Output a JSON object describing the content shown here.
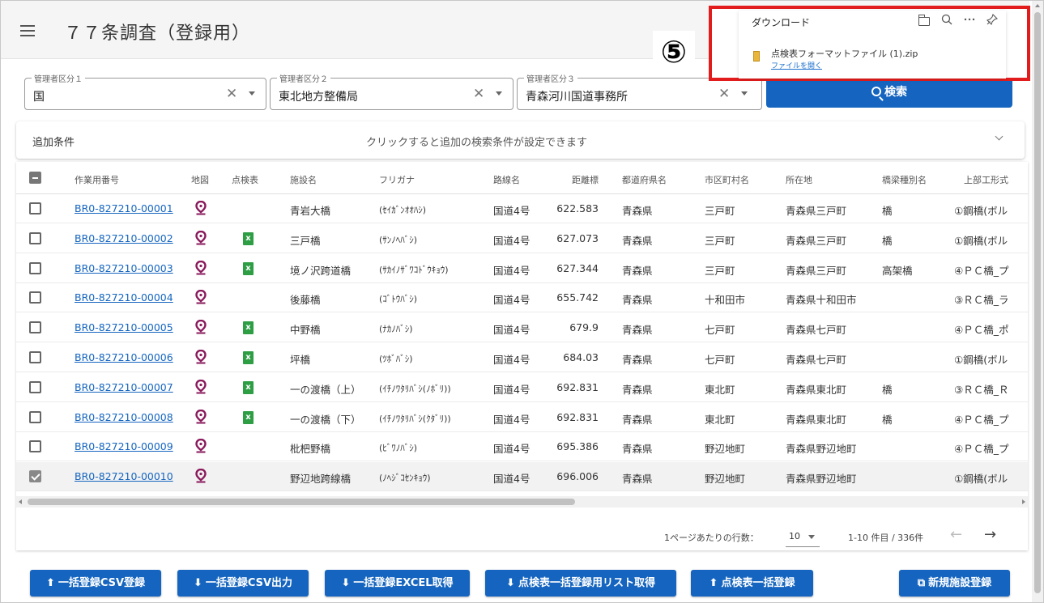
{
  "header": {
    "title": "７７条調査（登録用）"
  },
  "annotation": {
    "step_number": "⑤"
  },
  "download_panel": {
    "title": "ダウンロード",
    "icons": [
      "folder-icon",
      "search-icon",
      "more-icon",
      "pin-icon"
    ],
    "file_name": "点検表フォーマットファイル (1).zip",
    "open_link": "ファイルを開く"
  },
  "filters": {
    "field1": {
      "label": "管理者区分１",
      "value": "国"
    },
    "field2": {
      "label": "管理者区分２",
      "value": "東北地方整備局"
    },
    "field3": {
      "label": "管理者区分３",
      "value": "青森河川国道事務所"
    },
    "search_button": "検索"
  },
  "additional_conditions": {
    "label": "追加条件",
    "hint": "クリックすると追加の検索条件が設定できます"
  },
  "table": {
    "headers": {
      "id": "作業用番号",
      "map": "地図",
      "inspection": "点検表",
      "facility": "施設名",
      "furigana": "フリガナ",
      "route": "路線名",
      "distance": "距離標",
      "prefecture": "都道府県名",
      "city": "市区町村名",
      "location": "所在地",
      "bridge_type": "橋梁種別名",
      "structure": "上部工形式"
    },
    "rows": [
      {
        "id": "BR0-827210-00001",
        "has_sheet": false,
        "facility": "青岩大橋",
        "furigana": "(ｾｲｶﾞﾝｵｵﾊｼ)",
        "route": "国道4号",
        "distance": "622.583",
        "prefecture": "青森県",
        "city": "三戸町",
        "location": "青森県三戸町",
        "bridge_type": "橋",
        "structure": "①鋼橋(ボル",
        "checked": false
      },
      {
        "id": "BR0-827210-00002",
        "has_sheet": true,
        "facility": "三戸橋",
        "furigana": "(ｻﾝﾉﾍﾊﾞｼ)",
        "route": "国道4号",
        "distance": "627.073",
        "prefecture": "青森県",
        "city": "三戸町",
        "location": "青森県三戸町",
        "bridge_type": "橋",
        "structure": "①鋼橋(ボル",
        "checked": false
      },
      {
        "id": "BR0-827210-00003",
        "has_sheet": true,
        "facility": "境ノ沢跨道橋",
        "furigana": "(ｻｶｲﾉｻﾞﾜｺﾄﾞｳｷｮｳ)",
        "route": "国道4号",
        "distance": "627.344",
        "prefecture": "青森県",
        "city": "三戸町",
        "location": "青森県三戸町",
        "bridge_type": "高架橋",
        "structure": "④ＰＣ橋_プ",
        "checked": false
      },
      {
        "id": "BR0-827210-00004",
        "has_sheet": false,
        "facility": "後藤橋",
        "furigana": "(ｺﾞﾄｳﾊﾞｼ)",
        "route": "国道4号",
        "distance": "655.742",
        "prefecture": "青森県",
        "city": "十和田市",
        "location": "青森県十和田市",
        "bridge_type": "",
        "structure": "③ＲＣ橋_ラ",
        "checked": false
      },
      {
        "id": "BR0-827210-00005",
        "has_sheet": true,
        "facility": "中野橋",
        "furigana": "(ﾅｶﾉﾊﾞｼ)",
        "route": "国道4号",
        "distance": "679.9",
        "prefecture": "青森県",
        "city": "七戸町",
        "location": "青森県七戸町",
        "bridge_type": "",
        "structure": "④ＰＣ橋_ポ",
        "checked": false
      },
      {
        "id": "BR0-827210-00006",
        "has_sheet": true,
        "facility": "坪橋",
        "furigana": "(ﾂﾎﾞﾊﾞｼ)",
        "route": "国道4号",
        "distance": "684.03",
        "prefecture": "青森県",
        "city": "七戸町",
        "location": "青森県七戸町",
        "bridge_type": "",
        "structure": "①鋼橋(ボル",
        "checked": false
      },
      {
        "id": "BR0-827210-00007",
        "has_sheet": true,
        "facility": "一の渡橋（上）",
        "furigana": "(ｲﾁﾉﾜﾀﾘﾊﾞｼ(ﾉﾎﾞﾘ))",
        "route": "国道4号",
        "distance": "692.831",
        "prefecture": "青森県",
        "city": "東北町",
        "location": "青森県東北町",
        "bridge_type": "橋",
        "structure": "③ＲＣ橋_Ｒ",
        "checked": false
      },
      {
        "id": "BR0-827210-00008",
        "has_sheet": true,
        "facility": "一の渡橋（下）",
        "furigana": "(ｲﾁﾉﾜﾀﾘﾊﾞｼ(ｸﾀﾞﾘ))",
        "route": "国道4号",
        "distance": "692.831",
        "prefecture": "青森県",
        "city": "東北町",
        "location": "青森県東北町",
        "bridge_type": "橋",
        "structure": "④ＰＣ橋_プ",
        "checked": false
      },
      {
        "id": "BR0-827210-00009",
        "has_sheet": false,
        "facility": "枇杷野橋",
        "furigana": "(ﾋﾞﾜﾉﾊﾞｼ)",
        "route": "国道4号",
        "distance": "695.386",
        "prefecture": "青森県",
        "city": "野辺地町",
        "location": "青森県野辺地町",
        "bridge_type": "",
        "structure": "④ＰＣ橋_プ",
        "checked": false
      },
      {
        "id": "BR0-827210-00010",
        "has_sheet": false,
        "facility": "野辺地跨線橋",
        "furigana": "(ﾉﾍｼﾞｺｾﾝｷｮｳ)",
        "route": "国道4号",
        "distance": "696.006",
        "prefecture": "青森県",
        "city": "野辺地町",
        "location": "青森県野辺地町",
        "bridge_type": "",
        "structure": "①鋼橋(ボル",
        "checked": true
      }
    ]
  },
  "pagination": {
    "rows_per_page_label": "1ページあたりの行数：",
    "rows_per_page": "10",
    "range": "1-10 件目 / 336件",
    "prev": "←",
    "next": "→"
  },
  "buttons": {
    "bulk_csv_register": "一括登録CSV登録",
    "bulk_csv_export": "一括登録CSV出力",
    "bulk_excel_get": "一括登録EXCEL取得",
    "inspection_list_get": "点検表一括登録用リスト取得",
    "inspection_bulk_register": "点検表一括登録",
    "new_facility": "新規施設登録"
  },
  "colors": {
    "primary": "#1565c0",
    "highlight_border": "#e21c1c",
    "map_pin": "#8a1a5c",
    "excel": "#2e9e45"
  }
}
